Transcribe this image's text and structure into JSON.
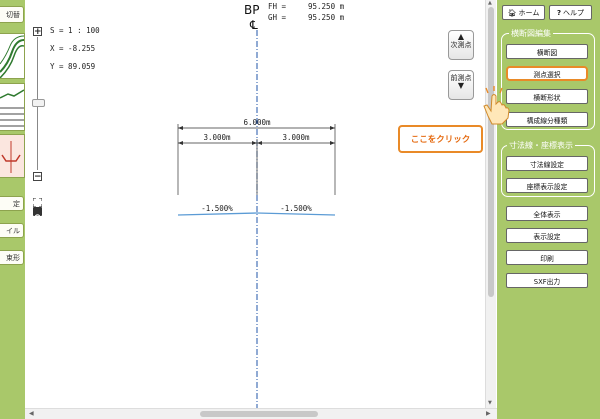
{
  "left_sidebar": {
    "buttons": [
      {
        "label": "切替"
      },
      {
        "label": "定"
      },
      {
        "label": "イル"
      },
      {
        "label": "束形"
      }
    ]
  },
  "canvas": {
    "scale_text": "S = 1 : 100",
    "x_text": "X = -8.255",
    "y_text": "Y = 89.059",
    "station_label": "BP",
    "centerline_symbol": "℄",
    "fh_label": "FH =",
    "fh_value": "95.250 m",
    "gh_label": "GH =",
    "gh_value": "95.250 m",
    "zoom_in": "+",
    "zoom_out": "−",
    "next_point_label": "次測点",
    "prev_point_label": "前測点",
    "total_width": "6.000m",
    "left_width": "3.000m",
    "right_width": "3.000m",
    "left_slope": "-1.500%",
    "right_slope": "-1.500%",
    "colors": {
      "slope_line": "#5b9bd5",
      "centerline": "#2255aa"
    }
  },
  "right_panel": {
    "home_label": "ホーム",
    "help_label": "ヘルプ",
    "group1_title": "横断図編集",
    "group1_buttons": [
      {
        "label": "横断図"
      },
      {
        "label": "測点選択"
      },
      {
        "label": "横断形状"
      },
      {
        "label": "構成線分種類"
      }
    ],
    "group2_title": "寸法線・座標表示",
    "group2_buttons": [
      {
        "label": "寸法線設定"
      },
      {
        "label": "座標表示設定"
      }
    ],
    "other_buttons": [
      {
        "label": "全体表示"
      },
      {
        "label": "表示設定"
      },
      {
        "label": "印刷"
      },
      {
        "label": "SXF出力"
      }
    ]
  },
  "callout": {
    "text": "ここをクリック",
    "accent_color": "#e98a28"
  }
}
